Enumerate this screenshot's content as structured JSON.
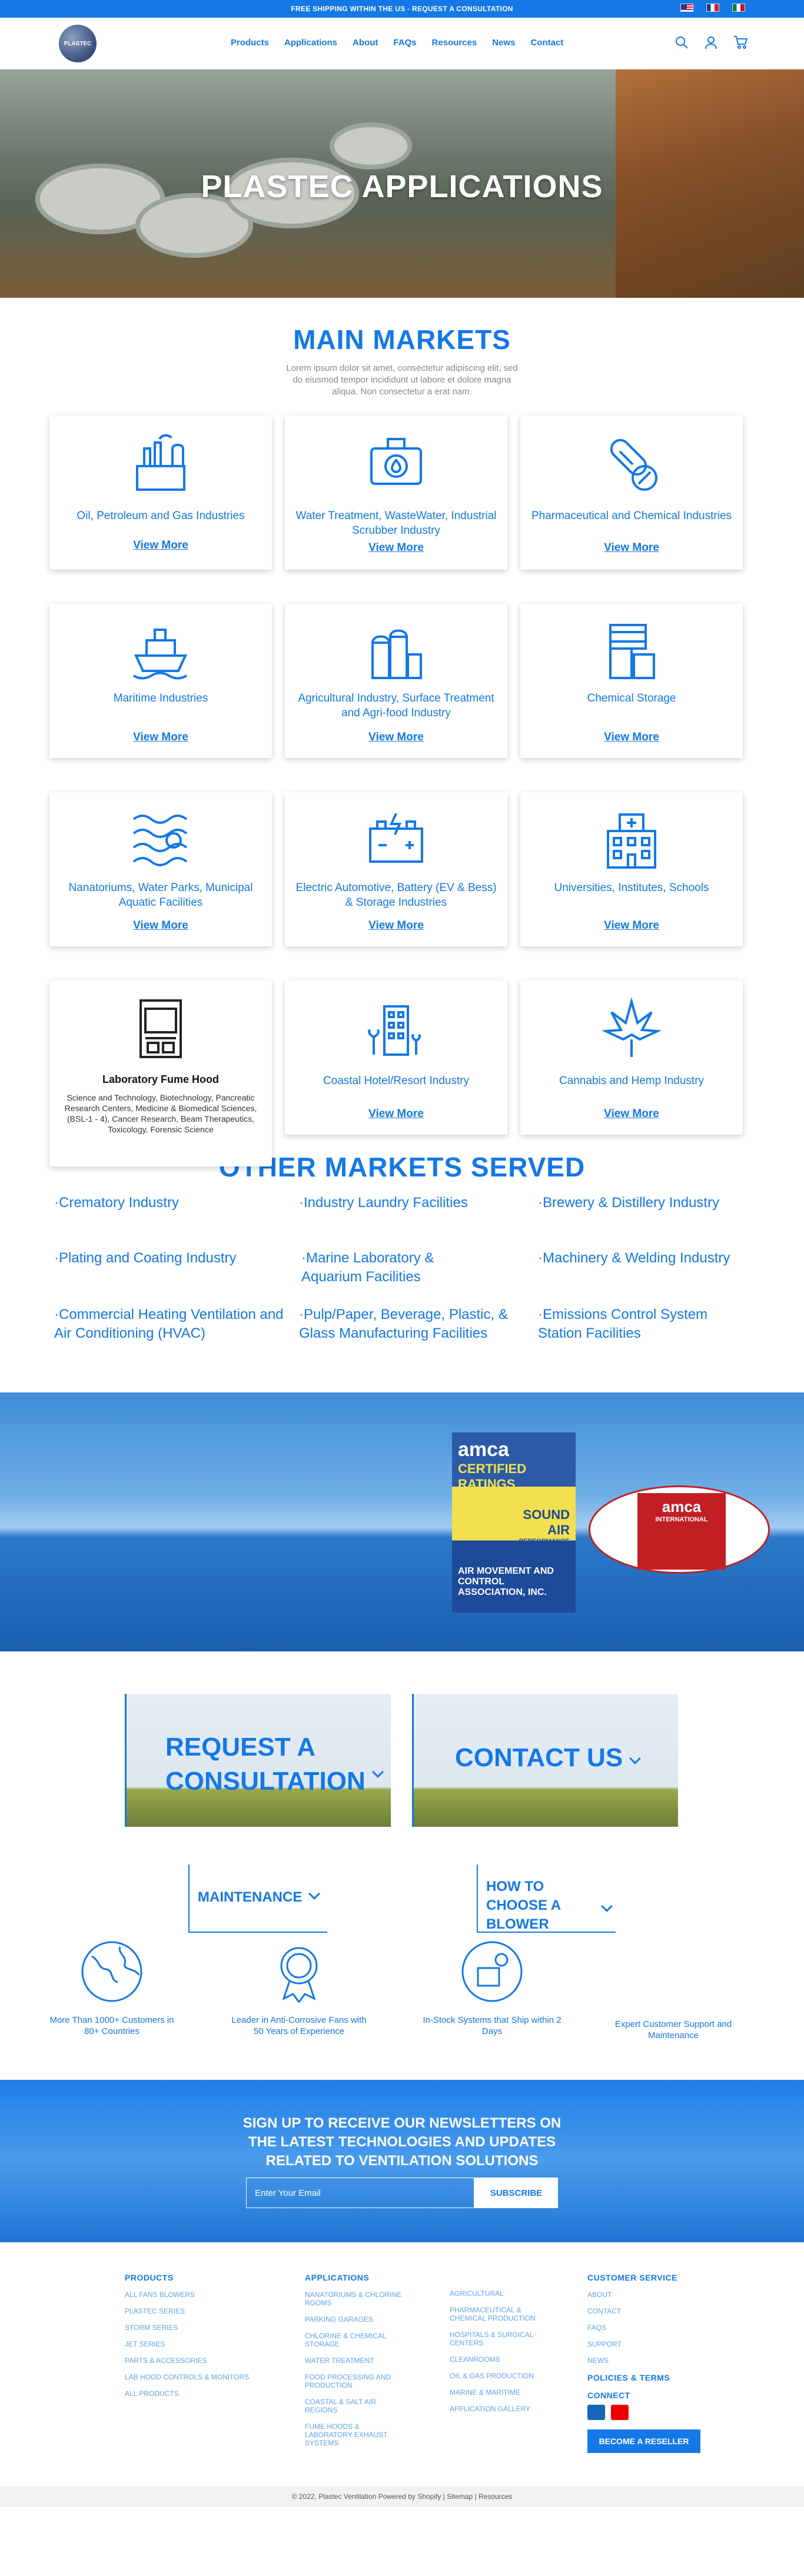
{
  "topbar": {
    "text": "FREE SHIPPING WITHIN THE US - REQUEST A CONSULTATION",
    "flags": [
      "us-flag",
      "fr-flag",
      "mx-flag"
    ]
  },
  "header": {
    "logo_text": "PLASTEC",
    "nav": [
      "Products",
      "Applications",
      "About",
      "FAQs",
      "Resources",
      "News",
      "Contact"
    ],
    "icons": [
      "search-icon",
      "account-icon",
      "cart-icon"
    ]
  },
  "hero": {
    "title": "PLASTEC APPLICATIONS"
  },
  "main_markets": {
    "title": "MAIN MARKETS",
    "intro": "Lorem ipsum dolor sit amet, consectetur adipiscing elit, sed do eiusmod tempor incididunt ut labore et dolore magna aliqua. Non consectetur a erat nam.",
    "cards": [
      {
        "title": "Oil, Petroleum and Gas Industries",
        "link": "View More",
        "icon": "refinery-icon"
      },
      {
        "title": "Water Treatment, WasteWater, Industrial Scrubber Industry",
        "link": "View More",
        "icon": "water-pump-icon"
      },
      {
        "title": "Pharmaceutical and Chemical Industries",
        "link": "View More",
        "icon": "pill-icon"
      },
      {
        "title": "Maritime Industries",
        "link": "View More",
        "icon": "ship-icon"
      },
      {
        "title": "Agricultural Industry, Surface Treatment and Agri-food Industry",
        "link": "View More",
        "icon": "silo-icon"
      },
      {
        "title": "Chemical Storage",
        "link": "View More",
        "icon": "barrels-icon"
      },
      {
        "title": "Nanatoriums, Water Parks, Municipal Aquatic Facilities",
        "link": "View More",
        "icon": "waves-icon"
      },
      {
        "title": "Electric Automotive, Battery (EV & Bess) & Storage Industries",
        "link": "View More",
        "icon": "battery-icon"
      },
      {
        "title": "Universities, Institutes, Schools",
        "link": "View More",
        "icon": "building-icon"
      },
      {
        "title": "Laboratory Fume Hood",
        "desc": "Science and Technology, Biotechnology, Pancreatic Research Centers, Medicine & Biomedical Sciences, (BSL-1 - 4), Cancer Research, Beam Therapeutics, Toxicology, Forensic Science",
        "icon": "fume-hood-icon"
      },
      {
        "title": "Coastal Hotel/Resort Industry",
        "link": "View More",
        "icon": "hotel-icon"
      },
      {
        "title": "Cannabis and Hemp Industry",
        "link": "View More",
        "icon": "cannabis-leaf-icon"
      }
    ]
  },
  "other_markets": {
    "title": "OTHER MARKETS SERVED",
    "items": [
      "·Crematory Industry",
      "·Industry Laundry Facilities",
      "·Brewery & Distillery Industry",
      "·Plating and Coating Industry",
      "·Marine Laboratory & Aquarium Facilities",
      "·Machinery & Welding Industry",
      "·Commercial Heating Ventilation and Air Conditioning (HVAC)",
      "·Pulp/Paper, Beverage, Plastic, & Glass Manufacturing Facilities",
      "·Emissions Control System Station Facilities"
    ]
  },
  "certifications": {
    "amca_seal_lines": [
      "amca",
      "CERTIFIED",
      "RATINGS",
      "SOUND",
      "AIR",
      "PERFORMANCE",
      "AIR MOVEMENT AND CONTROL ASSOCIATION, INC."
    ],
    "amca_intl_lines": [
      "amca",
      "INTERNATIONAL"
    ]
  },
  "cta": {
    "request": "REQUEST A CONSULTATION",
    "contact": "CONTACT US",
    "maintenance": "MAINTENANCE",
    "choose": "HOW TO CHOOSE A BLOWER"
  },
  "features": [
    {
      "text": "More Than 1000+ Customers in 80+ Countries",
      "icon": "globe-icon"
    },
    {
      "text": "Leader in Anti-Corrosive Fans with 50 Years of Experience",
      "icon": "medal-icon"
    },
    {
      "text": "In-Stock Systems that Ship within 2 Days",
      "icon": "box-gear-icon"
    },
    {
      "text": "Expert Customer Support and Maintenance",
      "icon": "headset-icon"
    }
  ],
  "newsletter": {
    "title": "SIGN UP TO RECEIVE OUR NEWSLETTERS ON THE LATEST TECHNOLOGIES AND UPDATES RELATED TO VENTILATION SOLUTIONS",
    "placeholder": "Enter Your Email",
    "button": "SUBSCRIBE"
  },
  "footer": {
    "products_title": "PRODUCTS",
    "products": [
      "ALL FANS BLOWERS",
      "PLASTEC SERIES",
      "STORM SERIES",
      "JET SERIES",
      "PARTS & ACCESSORIES",
      "LAB HOOD CONTROLS & MONITORS",
      "ALL PRODUCTS"
    ],
    "applications_title": "APPLICATIONS",
    "applications_col1": [
      "NANATORIUMS & CHLORINE ROOMS",
      "PARKING GARAGES",
      "CHLORINE & CHEMICAL STORAGE",
      "WATER TREATMENT",
      "FOOD PROCESSING AND PRODUCTION",
      "COASTAL & SALT AIR REGIONS",
      "FUME HOODS & LABORATORY EXHAUST SYSTEMS"
    ],
    "applications_col2": [
      "AGRICULTURAL",
      "PHARMACEUTICAL & CHEMICAL PRODUCTION",
      "HOSPITALS & SURGICAL CENTERS",
      "CLEANROOMS",
      "OIL & GAS PRODUCTION",
      "MARINE & MARITIME",
      "APPLICATION GALLERY"
    ],
    "service_title": "CUSTOMER SERVICE",
    "service": [
      "ABOUT",
      "CONTACT",
      "FAQS",
      "SUPPORT",
      "NEWS"
    ],
    "policies": "POLICIES & TERMS",
    "connect": "CONNECT",
    "reseller": "BECOME A RESELLER",
    "copyright": "© 2022, Plastec Ventilation Powered by Shopify | Sitemap | Resources"
  }
}
